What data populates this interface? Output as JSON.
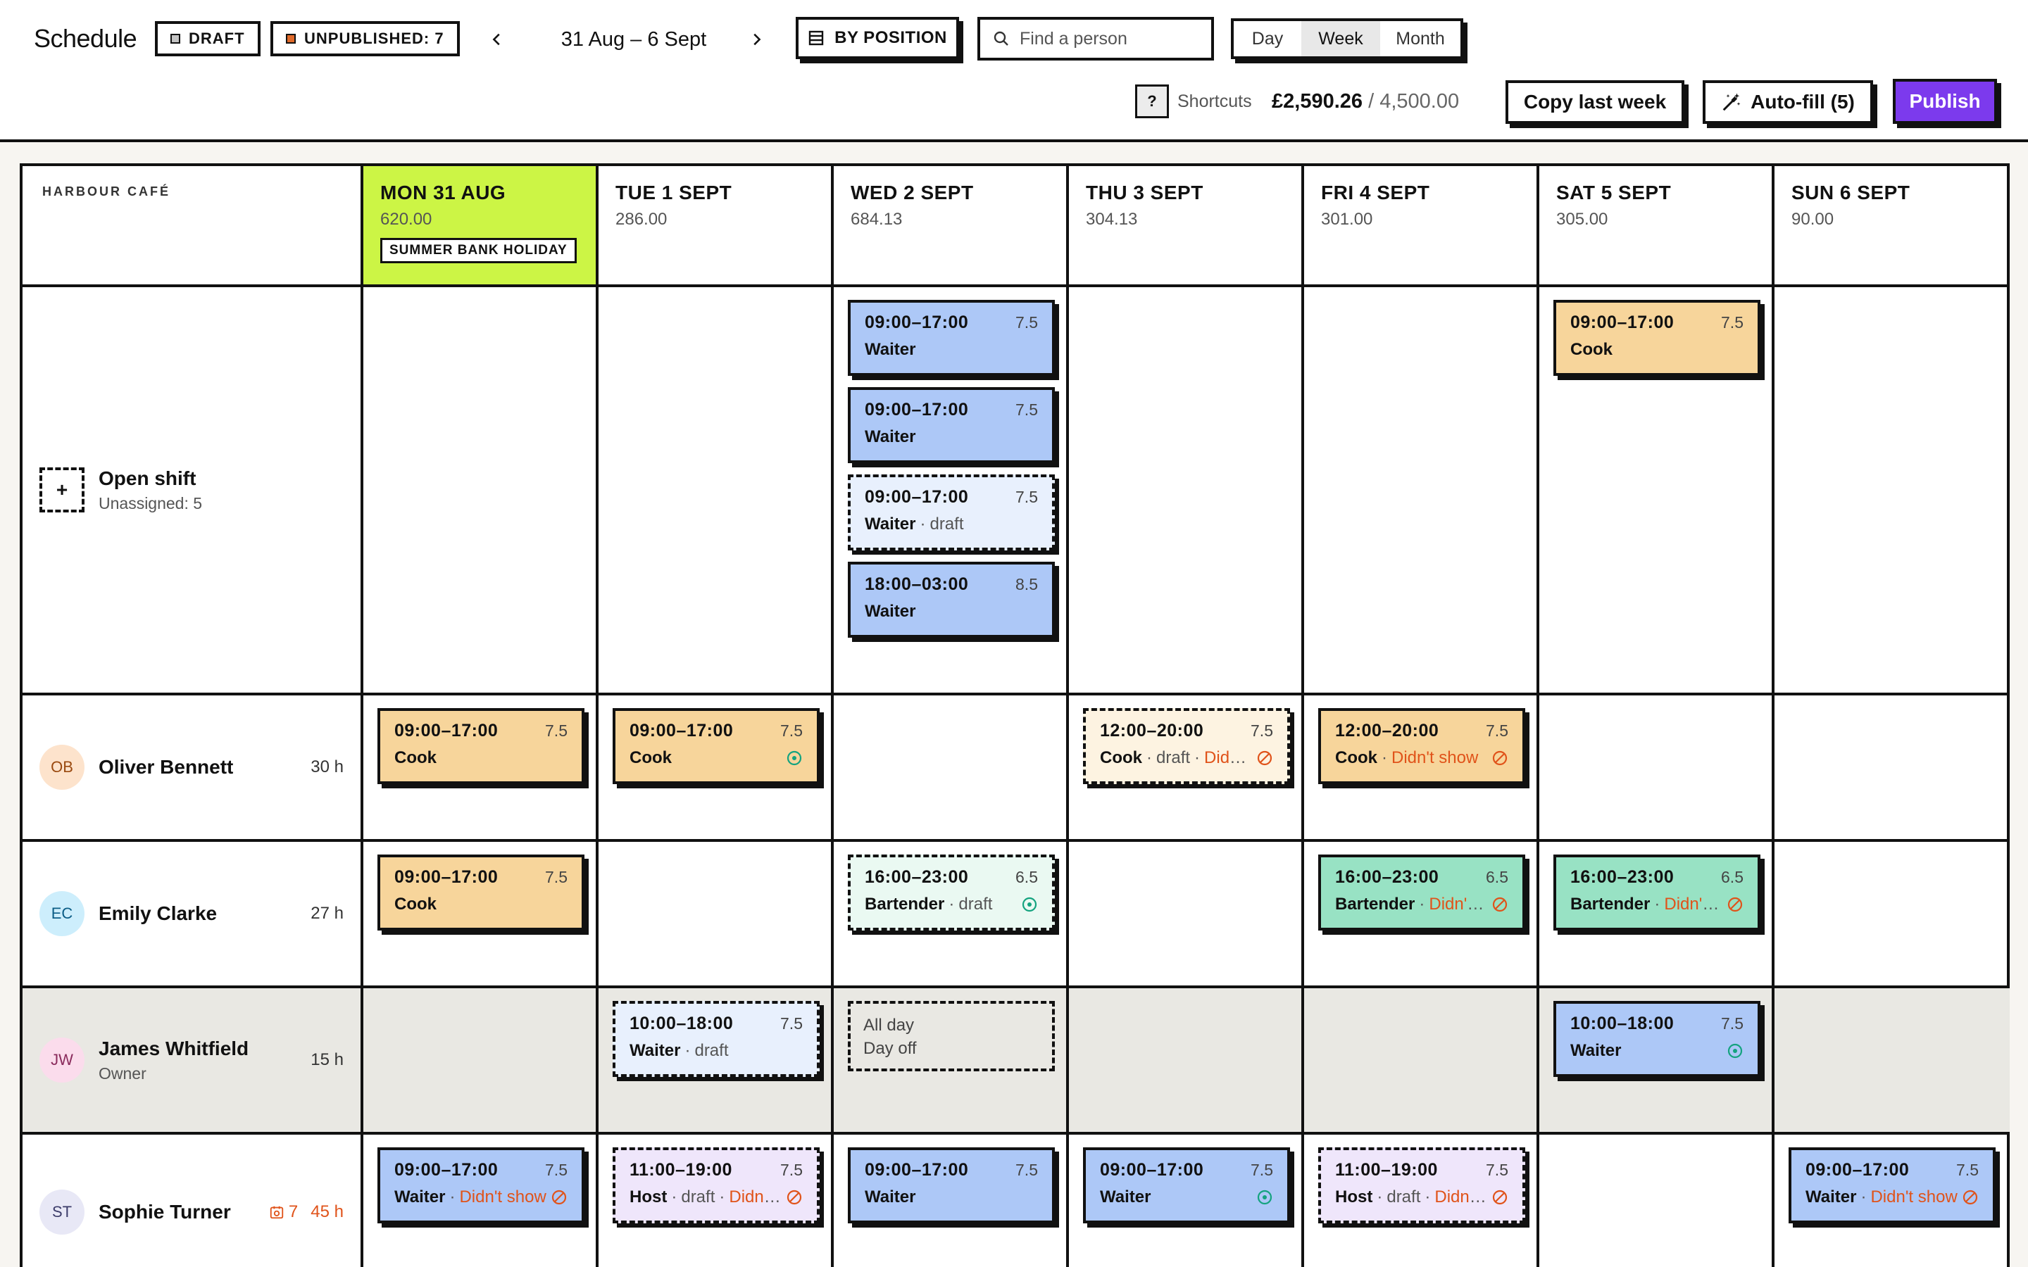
{
  "header": {
    "title": "Schedule",
    "draft_label": "DRAFT",
    "unpublished_label": "UNPUBLISHED: 7",
    "date_range": "31 Aug – 6 Sept",
    "group_by_label": "BY POSITION",
    "search_placeholder": "Find a person",
    "views": [
      "Day",
      "Week",
      "Month"
    ],
    "active_view": "Week",
    "shortcut_key": "?",
    "shortcuts_label": "Shortcuts",
    "budget_spent": "£2,590.26",
    "budget_total": "4,500.00",
    "copy_label": "Copy last week",
    "autofill_label": "Auto-fill (5)",
    "publish_label": "Publish"
  },
  "colors": {
    "cook": "#f7d59b",
    "waiter": "#adc8f7",
    "waiter_draft": "#e8f0fd",
    "cook_draft": "#fdf3e1",
    "bartender": "#98e2c4",
    "bartender_draft": "#eaf9f2",
    "host_draft": "#efe6fb",
    "today": "#ccf545",
    "publish": "#7c3aed",
    "warning": "#e0531a",
    "ok": "#14a37f"
  },
  "venue": "HARBOUR CAFÉ",
  "days": [
    {
      "name": "MON 31 AUG",
      "cost": "620.00",
      "holiday": "SUMMER BANK HOLIDAY"
    },
    {
      "name": "TUE 1 SEPT",
      "cost": "286.00"
    },
    {
      "name": "WED 2 SEPT",
      "cost": "684.13"
    },
    {
      "name": "THU 3 SEPT",
      "cost": "304.13"
    },
    {
      "name": "FRI 4 SEPT",
      "cost": "301.00"
    },
    {
      "name": "SAT 5 SEPT",
      "cost": "305.00"
    },
    {
      "name": "SUN 6 SEPT",
      "cost": "90.00"
    }
  ],
  "rows": [
    {
      "type": "open",
      "name": "Open shift",
      "sub": "Unassigned: 5",
      "cells": [
        [],
        [],
        [
          {
            "time": "09:00–17:00",
            "dur": "7.5",
            "pos": "Waiter",
            "color": "waiter"
          },
          {
            "time": "09:00–17:00",
            "dur": "7.5",
            "pos": "Waiter",
            "color": "waiter"
          },
          {
            "time": "09:00–17:00",
            "dur": "7.5",
            "pos": "Waiter",
            "color": "waiter_draft",
            "draft": true,
            "meta": [
              "draft"
            ]
          },
          {
            "time": "18:00–03:00",
            "dur": "8.5",
            "pos": "Waiter",
            "color": "waiter"
          }
        ],
        [],
        [],
        [
          {
            "time": "09:00–17:00",
            "dur": "7.5",
            "pos": "Cook",
            "color": "cook"
          }
        ],
        []
      ]
    },
    {
      "type": "person",
      "initials": "OB",
      "avatar_bg": "#fde3cc",
      "avatar_fg": "#9a4a10",
      "name": "Oliver Bennett",
      "hours": "30 h",
      "cells": [
        [
          {
            "time": "09:00–17:00",
            "dur": "7.5",
            "pos": "Cook",
            "color": "cook"
          }
        ],
        [
          {
            "time": "09:00–17:00",
            "dur": "7.5",
            "pos": "Cook",
            "color": "cook",
            "icon": "ok"
          }
        ],
        [],
        [
          {
            "time": "12:00–20:00",
            "dur": "7.5",
            "pos": "Cook",
            "color": "cook_draft",
            "draft": true,
            "meta": [
              "draft"
            ],
            "miss": "Didn't show",
            "icon": "warn"
          }
        ],
        [
          {
            "time": "12:00–20:00",
            "dur": "7.5",
            "pos": "Cook",
            "color": "cook",
            "miss": "Didn't show",
            "icon": "warn"
          }
        ],
        [],
        []
      ]
    },
    {
      "type": "person",
      "initials": "EC",
      "avatar_bg": "#cdeefc",
      "avatar_fg": "#0b5d86",
      "name": "Emily Clarke",
      "hours": "27 h",
      "cells": [
        [
          {
            "time": "09:00–17:00",
            "dur": "7.5",
            "pos": "Cook",
            "color": "cook"
          }
        ],
        [],
        [
          {
            "time": "16:00–23:00",
            "dur": "6.5",
            "pos": "Bartender",
            "color": "bartender_draft",
            "draft": true,
            "meta": [
              "draft"
            ],
            "icon": "ok"
          }
        ],
        [],
        [
          {
            "time": "16:00–23:00",
            "dur": "6.5",
            "pos": "Bartender",
            "color": "bartender",
            "miss": "Didn't show",
            "icon": "warn"
          }
        ],
        [
          {
            "time": "16:00–23:00",
            "dur": "6.5",
            "pos": "Bartender",
            "color": "bartender",
            "miss": "Didn't show",
            "icon": "warn"
          }
        ],
        []
      ]
    },
    {
      "type": "person",
      "gray": true,
      "initials": "JW",
      "avatar_bg": "#fbdcec",
      "avatar_fg": "#8a2b5c",
      "name": "James Whitfield",
      "role": "Owner",
      "hours": "15 h",
      "cells": [
        [],
        [
          {
            "time": "10:00–18:00",
            "dur": "7.5",
            "pos": "Waiter",
            "color": "waiter_draft",
            "draft": true,
            "meta": [
              "draft"
            ]
          }
        ],
        [
          {
            "dayoff": true,
            "line1": "All day",
            "line2": "Day off"
          }
        ],
        [],
        [],
        [
          {
            "time": "10:00–18:00",
            "dur": "7.5",
            "pos": "Waiter",
            "color": "waiter",
            "icon": "ok"
          }
        ],
        []
      ]
    },
    {
      "type": "person",
      "initials": "ST",
      "avatar_bg": "#e8e8f6",
      "avatar_fg": "#3c3c6a",
      "name": "Sophie Turner",
      "hours": "45 h",
      "hours_warn": true,
      "repeat_count": "7",
      "cells": [
        [
          {
            "time": "09:00–17:00",
            "dur": "7.5",
            "pos": "Waiter",
            "color": "waiter",
            "miss": "Didn't show",
            "icon": "warn"
          }
        ],
        [
          {
            "time": "11:00–19:00",
            "dur": "7.5",
            "pos": "Host",
            "color": "host_draft",
            "draft": true,
            "meta": [
              "draft"
            ],
            "miss": "Didn't show",
            "icon": "warn"
          }
        ],
        [
          {
            "time": "09:00–17:00",
            "dur": "7.5",
            "pos": "Waiter",
            "color": "waiter"
          }
        ],
        [
          {
            "time": "09:00–17:00",
            "dur": "7.5",
            "pos": "Waiter",
            "color": "waiter",
            "icon": "ok"
          }
        ],
        [
          {
            "time": "11:00–19:00",
            "dur": "7.5",
            "pos": "Host",
            "color": "host_draft",
            "draft": true,
            "meta": [
              "draft"
            ],
            "miss": "Didn't show",
            "icon": "warn"
          }
        ],
        [],
        [
          {
            "time": "09:00–17:00",
            "dur": "7.5",
            "pos": "Waiter",
            "color": "waiter",
            "miss": "Didn't show",
            "icon": "warn"
          }
        ]
      ]
    }
  ]
}
